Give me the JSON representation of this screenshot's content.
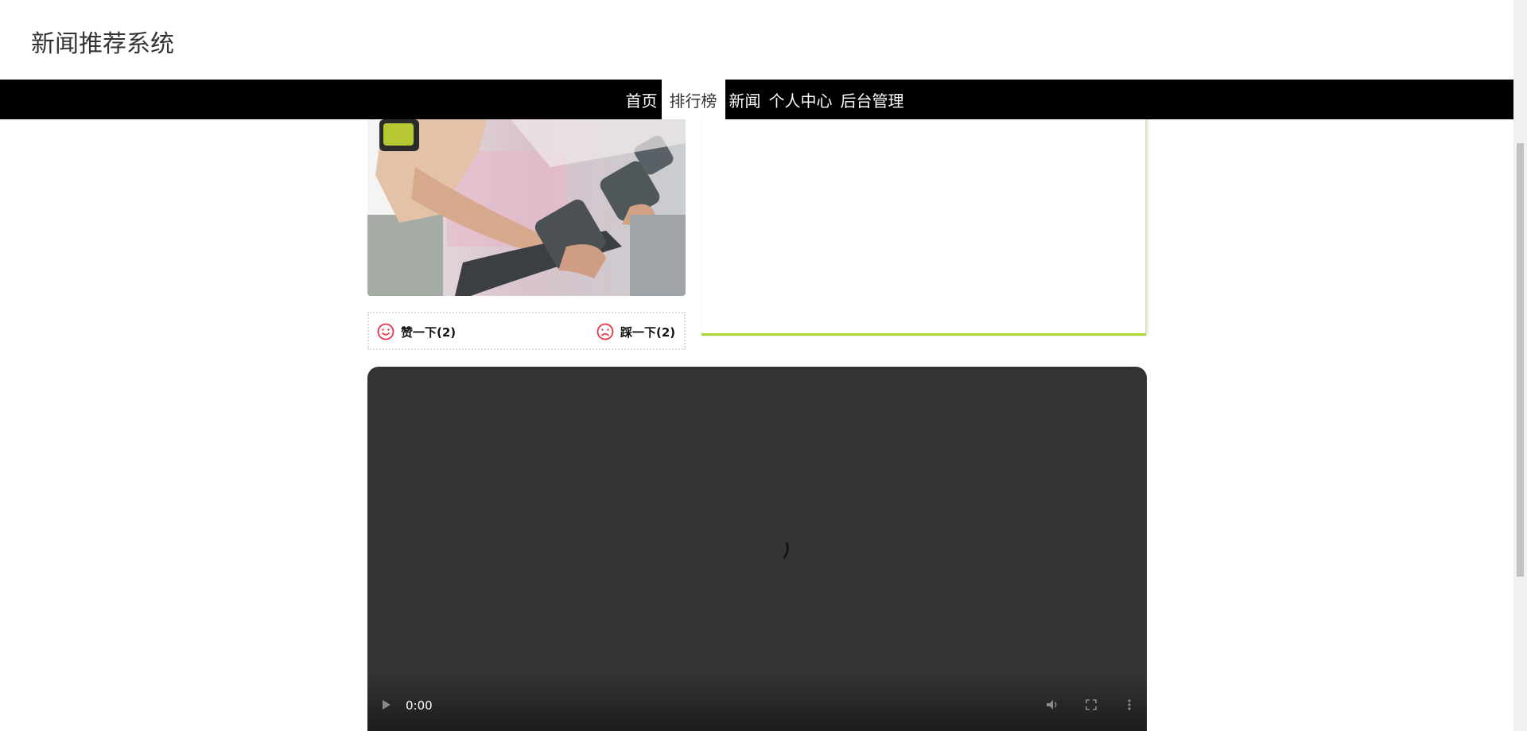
{
  "header": {
    "title": "新闻推荐系统"
  },
  "nav": {
    "items": [
      {
        "label": "首页",
        "active": false
      },
      {
        "label": "排行榜",
        "active": true
      },
      {
        "label": "新闻",
        "active": false
      },
      {
        "label": "个人中心",
        "active": false
      },
      {
        "label": "后台管理",
        "active": false
      }
    ]
  },
  "votes": {
    "like_label": "赞一下(2)",
    "dislike_label": "踩一下(2)",
    "icon_color": "#e8334a"
  },
  "video": {
    "current_time": "0:00",
    "background": "#333333"
  },
  "colors": {
    "nav_background": "#000000",
    "panel_accent": "#a9d535"
  }
}
